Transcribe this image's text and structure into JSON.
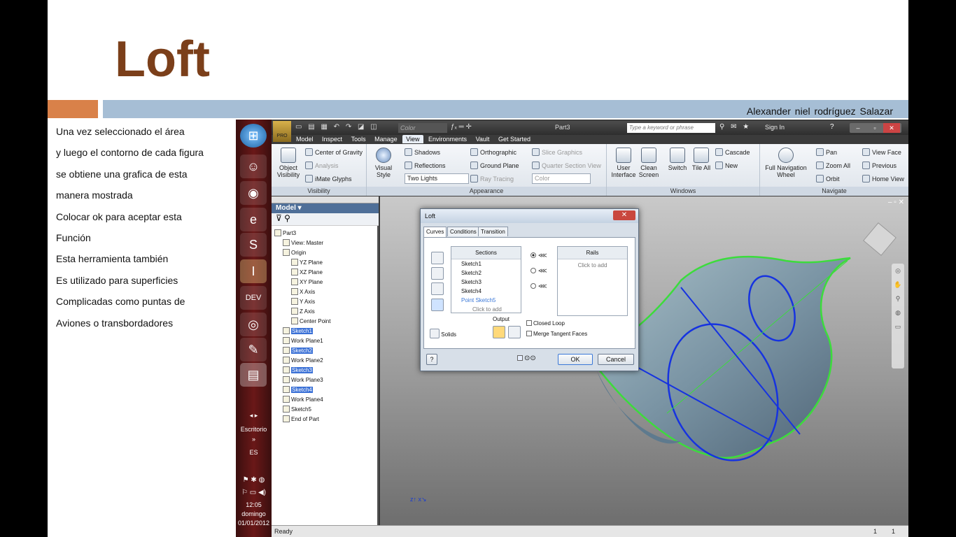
{
  "slide": {
    "title": "Loft",
    "author": "Alexander niel rodríguez Salazar",
    "bullets": [
      "Una vez seleccionado el área",
      "y luego el contorno de cada figura",
      "se obtiene una grafica de esta",
      "manera mostrada",
      "Colocar ok para aceptar esta",
      "Función",
      "Esta herramienta también",
      "Es utilizado para superficies",
      "Complicadas como puntas de",
      "Aviones  o transbordadores"
    ],
    "colors": {
      "title": "#7b3f1a",
      "orange_bar": "#d98149",
      "blue_bar": "#a6bed5"
    }
  },
  "taskbar": {
    "icons": [
      "windows-start-icon",
      "messenger-icon",
      "chrome-icon",
      "internet-explorer-icon",
      "skype-icon",
      "inventor-icon",
      "dev-icon",
      "cortana-eye-icon",
      "pen-icon",
      "folder-icon"
    ],
    "desktop_label": "Escritorio",
    "chevron": "»",
    "language": "ES",
    "time": "12:05",
    "day": "domingo",
    "date": "01/01/2012"
  },
  "app": {
    "title": "Part3",
    "color_select": "Color",
    "search_placeholder": "Type a keyword or phrase",
    "sign_in": "Sign In",
    "menu": [
      "Model",
      "Inspect",
      "Tools",
      "Manage",
      "View",
      "Environments",
      "Vault",
      "Get Started"
    ],
    "active_menu": "View",
    "ribbon": {
      "visibility": {
        "object_visibility": "Object Visibility",
        "center_of_gravity": "Center of Gravity",
        "analysis": "Analysis",
        "imate_glyphs": "iMate Glyphs",
        "label": "Visibility"
      },
      "appearance": {
        "visual_style": "Visual Style",
        "shadows": "Shadows",
        "reflections": "Reflections",
        "lighting": "Two Lights",
        "orthographic": "Orthographic",
        "ground_plane": "Ground Plane",
        "ray_tracing": "Ray Tracing",
        "slice_graphics": "Slice Graphics",
        "quarter_section_view": "Quarter Section View",
        "color": "Color",
        "label": "Appearance"
      },
      "windows": {
        "user_interface": "User Interface",
        "clean_screen": "Clean Screen",
        "switch": "Switch",
        "tile_all": "Tile All",
        "cascade": "Cascade",
        "new": "New",
        "label": "Windows"
      },
      "navigate": {
        "full_navigation_wheel": "Full Navigation Wheel",
        "pan": "Pan",
        "zoom_all": "Zoom All",
        "orbit": "Orbit",
        "view_face": "View Face",
        "previous": "Previous",
        "home_view": "Home View",
        "label": "Navigate"
      }
    },
    "browser": {
      "panel_title": "Model",
      "tree": [
        {
          "label": "Part3",
          "level": 0,
          "highlight": false
        },
        {
          "label": "View: Master",
          "level": 1,
          "highlight": false
        },
        {
          "label": "Origin",
          "level": 1,
          "highlight": false
        },
        {
          "label": "YZ Plane",
          "level": 2,
          "highlight": false
        },
        {
          "label": "XZ Plane",
          "level": 2,
          "highlight": false
        },
        {
          "label": "XY Plane",
          "level": 2,
          "highlight": false
        },
        {
          "label": "X Axis",
          "level": 2,
          "highlight": false
        },
        {
          "label": "Y Axis",
          "level": 2,
          "highlight": false
        },
        {
          "label": "Z Axis",
          "level": 2,
          "highlight": false
        },
        {
          "label": "Center Point",
          "level": 2,
          "highlight": false
        },
        {
          "label": "Sketch1",
          "level": 1,
          "highlight": true
        },
        {
          "label": "Work Plane1",
          "level": 1,
          "highlight": false
        },
        {
          "label": "Sketch2",
          "level": 1,
          "highlight": true
        },
        {
          "label": "Work Plane2",
          "level": 1,
          "highlight": false
        },
        {
          "label": "Sketch3",
          "level": 1,
          "highlight": true
        },
        {
          "label": "Work Plane3",
          "level": 1,
          "highlight": false
        },
        {
          "label": "Sketch4",
          "level": 1,
          "highlight": true
        },
        {
          "label": "Work Plane4",
          "level": 1,
          "highlight": false
        },
        {
          "label": "Sketch5",
          "level": 1,
          "highlight": false
        },
        {
          "label": "End of Part",
          "level": 1,
          "highlight": false
        }
      ]
    },
    "dialog": {
      "title": "Loft",
      "tabs": [
        "Curves",
        "Conditions",
        "Transition"
      ],
      "sections_header": "Sections",
      "sections": [
        "Sketch1",
        "Sketch2",
        "Sketch3",
        "Sketch4",
        "Point Sketch5"
      ],
      "click_to_add": "Click to add",
      "rails_header": "Rails",
      "rails_click_to_add": "Click to add",
      "output_label": "Output",
      "solids_label": "Solids",
      "closed_loop": "Closed Loop",
      "merge_tangent_faces": "Merge Tangent Faces",
      "ok": "OK",
      "cancel": "Cancel",
      "help": "?"
    },
    "status": {
      "text": "Ready",
      "count_a": "1",
      "count_b": "1"
    }
  }
}
